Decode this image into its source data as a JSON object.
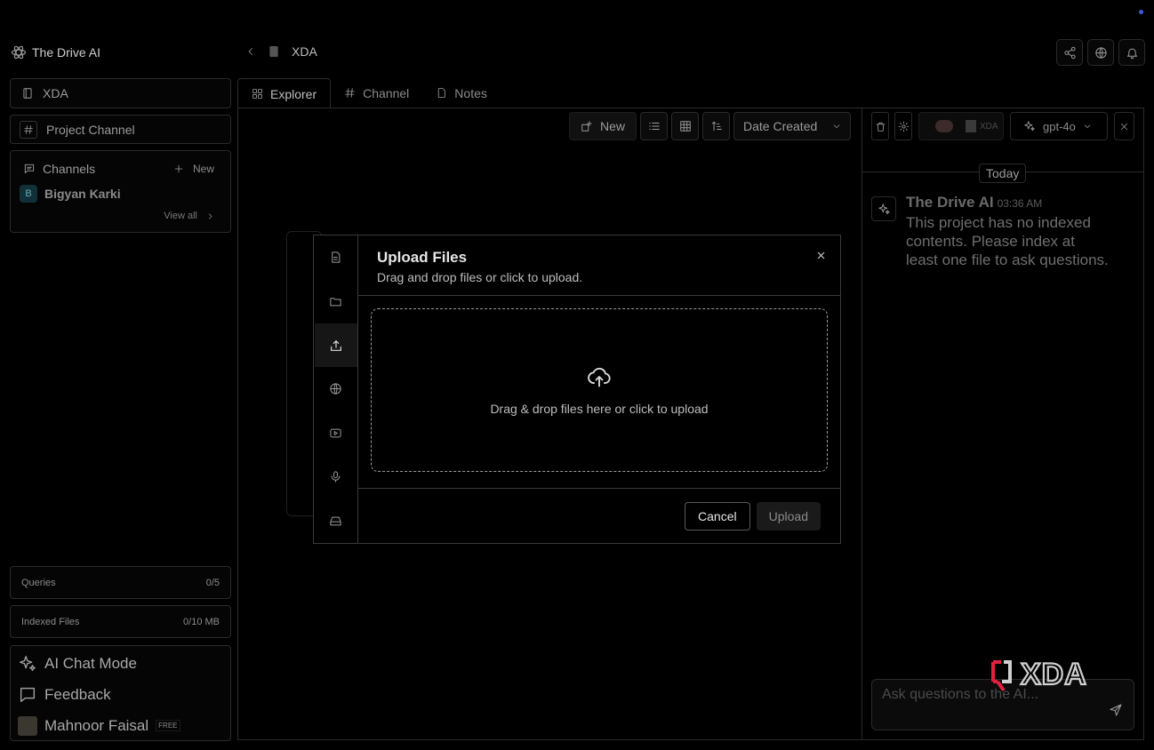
{
  "app": {
    "brand": "The Drive AI"
  },
  "breadcrumb": {
    "project": "XDA"
  },
  "sidebar": {
    "project_name": "XDA",
    "project_channel": "Project Channel",
    "channels_title": "Channels",
    "new_label": "New",
    "member": {
      "initial": "B",
      "name": "Bigyan Karki"
    },
    "view_all": "View all",
    "queries": {
      "label": "Queries",
      "value": "0/5"
    },
    "indexed_files": {
      "label": "Indexed Files",
      "value": "0/10 MB"
    },
    "ai_chat_mode": "AI Chat Mode",
    "feedback": "Feedback",
    "user": {
      "name": "Mahnoor Faisal",
      "plan": "FREE"
    }
  },
  "tabs": [
    {
      "label": "Explorer",
      "icon": "grid-icon"
    },
    {
      "label": "Channel",
      "icon": "hash-icon"
    },
    {
      "label": "Notes",
      "icon": "note-icon"
    }
  ],
  "toolbar": {
    "new_label": "New",
    "sort_label": "Date Created"
  },
  "chat": {
    "project_tag": "XDA",
    "model": "gpt-4o",
    "day_separator": "Today",
    "sender": "The Drive AI",
    "time": "03:36 AM",
    "message": "This project has no indexed contents. Please index at least one file to ask questions.",
    "input_placeholder": "Ask questions to the AI..."
  },
  "modal": {
    "title": "Upload Files",
    "subtitle": "Drag and drop files or click to upload.",
    "dropzone_text": "Drag & drop files here or click to upload",
    "cancel_label": "Cancel",
    "upload_label": "Upload",
    "sources": [
      "document-icon",
      "folder-icon",
      "upload-icon",
      "globe-icon",
      "youtube-icon",
      "microphone-icon",
      "drive-icon"
    ]
  },
  "watermark": "XDA",
  "colors": {
    "accent_dot": "#3b5bdb",
    "background": "#000000",
    "border": "#2a2a2a"
  }
}
